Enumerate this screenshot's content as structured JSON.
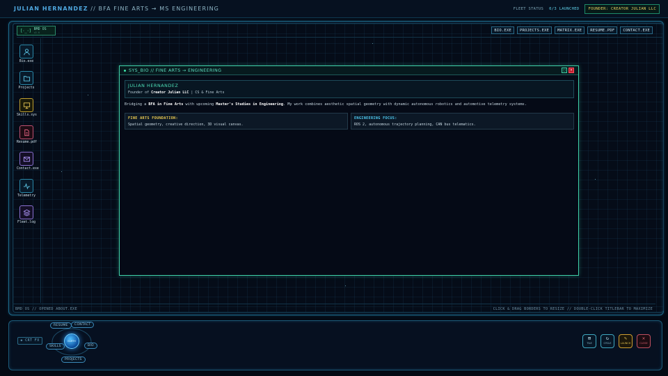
{
  "topbar": {
    "name": "JULIAN HERNANDEZ",
    "title_rest": "// BFA FINE ARTS  → MS ENGINEERING",
    "fleet_label": "FLEET STATUS",
    "fleet_value": "0/3 LAUNCHED",
    "founder_badge": "FOUNDER: CREATOR JULIAN LLC"
  },
  "logo": {
    "face": "[·_·]",
    "name": "BMD OS",
    "sub": "v2.0"
  },
  "quick_links": [
    "BIO.EXE",
    "PROJECTS.EXE",
    "MATRIX.EXE",
    "RESUME.PDF",
    "CONTACT.EXE"
  ],
  "desktop_icons": [
    {
      "label": "Bio.exe",
      "icon": "user-icon"
    },
    {
      "label": "Projects",
      "icon": "folder-icon"
    },
    {
      "label": "Skills.sys",
      "icon": "monitor-icon"
    },
    {
      "label": "Resume.pdf",
      "icon": "document-icon"
    },
    {
      "label": "Contact.exe",
      "icon": "mail-icon"
    },
    {
      "label": "Telemetry",
      "icon": "pulse-icon"
    },
    {
      "label": "Fleet.log",
      "icon": "layers-icon"
    }
  ],
  "window": {
    "title": "SYS_BIO // FINE ARTS → ENGINEERING",
    "maximize": "□",
    "close": "×",
    "profile_name": "JULIAN HERNANDEZ",
    "profile_prefix": "Founder of",
    "profile_company": "Creator Julian LLC",
    "profile_suffix": "| CS & Fine Arts",
    "bio_p1": "Bridging a",
    "bio_b1": "BFA in Fine Arts",
    "bio_p2": "with upcoming",
    "bio_b2": "Master's Studies in Engineering",
    "bio_p3": ". My work combines aesthetic spatial geometry with dynamic autonomous robotics and automotive telemetry systems.",
    "fine_arts_heading": "FINE ARTS FOUNDATION:",
    "fine_arts_body": "Spatial geometry, creative direction, 3D visual canvas.",
    "eng_heading": "ENGINEERING FOCUS:",
    "eng_body": "ROS 2, autonomous trajectory planning, CAN bus telematics."
  },
  "statusbar": {
    "left": "BMD OS // OPENED ABOUT.EXE",
    "right": "CLICK & DRAG BORDERS TO RESIZE // DOUBLE-CLICK TITLEBAR TO MAXIMIZE"
  },
  "dock": {
    "crt": "◈ CRT FX",
    "earth": "EARTH",
    "orbit_labels": {
      "resume": "RESUME",
      "contact": "CONTACT",
      "bio": "BIO",
      "skills": "SKILLS",
      "projects": "PROJECTS"
    },
    "buttons": [
      {
        "label": "TILE",
        "glyph": "⊞"
      },
      {
        "label": "CYCLE",
        "glyph": "↻"
      },
      {
        "label": "LAUNCH",
        "glyph": "✎"
      },
      {
        "label": "CLOSE",
        "glyph": "✕"
      }
    ]
  },
  "colors": {
    "accent": "#3ed0a8",
    "frame": "#1c6a8a",
    "warning": "#e0c050",
    "danger": "#c02030"
  }
}
